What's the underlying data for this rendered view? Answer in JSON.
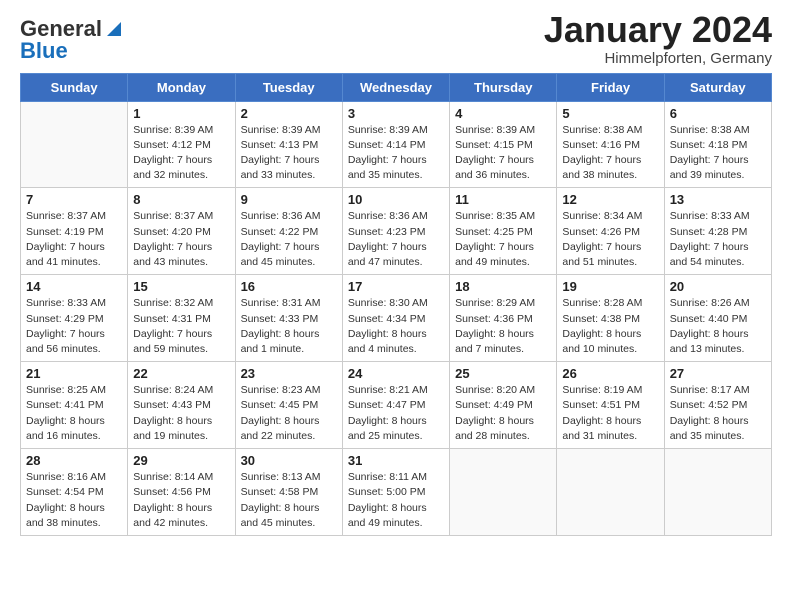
{
  "header": {
    "logo_general": "General",
    "logo_blue": "Blue",
    "month_year": "January 2024",
    "location": "Himmelpforten, Germany"
  },
  "weekdays": [
    "Sunday",
    "Monday",
    "Tuesday",
    "Wednesday",
    "Thursday",
    "Friday",
    "Saturday"
  ],
  "weeks": [
    [
      {
        "day": "",
        "sunrise": "",
        "sunset": "",
        "daylight": ""
      },
      {
        "day": "1",
        "sunrise": "Sunrise: 8:39 AM",
        "sunset": "Sunset: 4:12 PM",
        "daylight": "Daylight: 7 hours and 32 minutes."
      },
      {
        "day": "2",
        "sunrise": "Sunrise: 8:39 AM",
        "sunset": "Sunset: 4:13 PM",
        "daylight": "Daylight: 7 hours and 33 minutes."
      },
      {
        "day": "3",
        "sunrise": "Sunrise: 8:39 AM",
        "sunset": "Sunset: 4:14 PM",
        "daylight": "Daylight: 7 hours and 35 minutes."
      },
      {
        "day": "4",
        "sunrise": "Sunrise: 8:39 AM",
        "sunset": "Sunset: 4:15 PM",
        "daylight": "Daylight: 7 hours and 36 minutes."
      },
      {
        "day": "5",
        "sunrise": "Sunrise: 8:38 AM",
        "sunset": "Sunset: 4:16 PM",
        "daylight": "Daylight: 7 hours and 38 minutes."
      },
      {
        "day": "6",
        "sunrise": "Sunrise: 8:38 AM",
        "sunset": "Sunset: 4:18 PM",
        "daylight": "Daylight: 7 hours and 39 minutes."
      }
    ],
    [
      {
        "day": "7",
        "sunrise": "Sunrise: 8:37 AM",
        "sunset": "Sunset: 4:19 PM",
        "daylight": "Daylight: 7 hours and 41 minutes."
      },
      {
        "day": "8",
        "sunrise": "Sunrise: 8:37 AM",
        "sunset": "Sunset: 4:20 PM",
        "daylight": "Daylight: 7 hours and 43 minutes."
      },
      {
        "day": "9",
        "sunrise": "Sunrise: 8:36 AM",
        "sunset": "Sunset: 4:22 PM",
        "daylight": "Daylight: 7 hours and 45 minutes."
      },
      {
        "day": "10",
        "sunrise": "Sunrise: 8:36 AM",
        "sunset": "Sunset: 4:23 PM",
        "daylight": "Daylight: 7 hours and 47 minutes."
      },
      {
        "day": "11",
        "sunrise": "Sunrise: 8:35 AM",
        "sunset": "Sunset: 4:25 PM",
        "daylight": "Daylight: 7 hours and 49 minutes."
      },
      {
        "day": "12",
        "sunrise": "Sunrise: 8:34 AM",
        "sunset": "Sunset: 4:26 PM",
        "daylight": "Daylight: 7 hours and 51 minutes."
      },
      {
        "day": "13",
        "sunrise": "Sunrise: 8:33 AM",
        "sunset": "Sunset: 4:28 PM",
        "daylight": "Daylight: 7 hours and 54 minutes."
      }
    ],
    [
      {
        "day": "14",
        "sunrise": "Sunrise: 8:33 AM",
        "sunset": "Sunset: 4:29 PM",
        "daylight": "Daylight: 7 hours and 56 minutes."
      },
      {
        "day": "15",
        "sunrise": "Sunrise: 8:32 AM",
        "sunset": "Sunset: 4:31 PM",
        "daylight": "Daylight: 7 hours and 59 minutes."
      },
      {
        "day": "16",
        "sunrise": "Sunrise: 8:31 AM",
        "sunset": "Sunset: 4:33 PM",
        "daylight": "Daylight: 8 hours and 1 minute."
      },
      {
        "day": "17",
        "sunrise": "Sunrise: 8:30 AM",
        "sunset": "Sunset: 4:34 PM",
        "daylight": "Daylight: 8 hours and 4 minutes."
      },
      {
        "day": "18",
        "sunrise": "Sunrise: 8:29 AM",
        "sunset": "Sunset: 4:36 PM",
        "daylight": "Daylight: 8 hours and 7 minutes."
      },
      {
        "day": "19",
        "sunrise": "Sunrise: 8:28 AM",
        "sunset": "Sunset: 4:38 PM",
        "daylight": "Daylight: 8 hours and 10 minutes."
      },
      {
        "day": "20",
        "sunrise": "Sunrise: 8:26 AM",
        "sunset": "Sunset: 4:40 PM",
        "daylight": "Daylight: 8 hours and 13 minutes."
      }
    ],
    [
      {
        "day": "21",
        "sunrise": "Sunrise: 8:25 AM",
        "sunset": "Sunset: 4:41 PM",
        "daylight": "Daylight: 8 hours and 16 minutes."
      },
      {
        "day": "22",
        "sunrise": "Sunrise: 8:24 AM",
        "sunset": "Sunset: 4:43 PM",
        "daylight": "Daylight: 8 hours and 19 minutes."
      },
      {
        "day": "23",
        "sunrise": "Sunrise: 8:23 AM",
        "sunset": "Sunset: 4:45 PM",
        "daylight": "Daylight: 8 hours and 22 minutes."
      },
      {
        "day": "24",
        "sunrise": "Sunrise: 8:21 AM",
        "sunset": "Sunset: 4:47 PM",
        "daylight": "Daylight: 8 hours and 25 minutes."
      },
      {
        "day": "25",
        "sunrise": "Sunrise: 8:20 AM",
        "sunset": "Sunset: 4:49 PM",
        "daylight": "Daylight: 8 hours and 28 minutes."
      },
      {
        "day": "26",
        "sunrise": "Sunrise: 8:19 AM",
        "sunset": "Sunset: 4:51 PM",
        "daylight": "Daylight: 8 hours and 31 minutes."
      },
      {
        "day": "27",
        "sunrise": "Sunrise: 8:17 AM",
        "sunset": "Sunset: 4:52 PM",
        "daylight": "Daylight: 8 hours and 35 minutes."
      }
    ],
    [
      {
        "day": "28",
        "sunrise": "Sunrise: 8:16 AM",
        "sunset": "Sunset: 4:54 PM",
        "daylight": "Daylight: 8 hours and 38 minutes."
      },
      {
        "day": "29",
        "sunrise": "Sunrise: 8:14 AM",
        "sunset": "Sunset: 4:56 PM",
        "daylight": "Daylight: 8 hours and 42 minutes."
      },
      {
        "day": "30",
        "sunrise": "Sunrise: 8:13 AM",
        "sunset": "Sunset: 4:58 PM",
        "daylight": "Daylight: 8 hours and 45 minutes."
      },
      {
        "day": "31",
        "sunrise": "Sunrise: 8:11 AM",
        "sunset": "Sunset: 5:00 PM",
        "daylight": "Daylight: 8 hours and 49 minutes."
      },
      {
        "day": "",
        "sunrise": "",
        "sunset": "",
        "daylight": ""
      },
      {
        "day": "",
        "sunrise": "",
        "sunset": "",
        "daylight": ""
      },
      {
        "day": "",
        "sunrise": "",
        "sunset": "",
        "daylight": ""
      }
    ]
  ]
}
